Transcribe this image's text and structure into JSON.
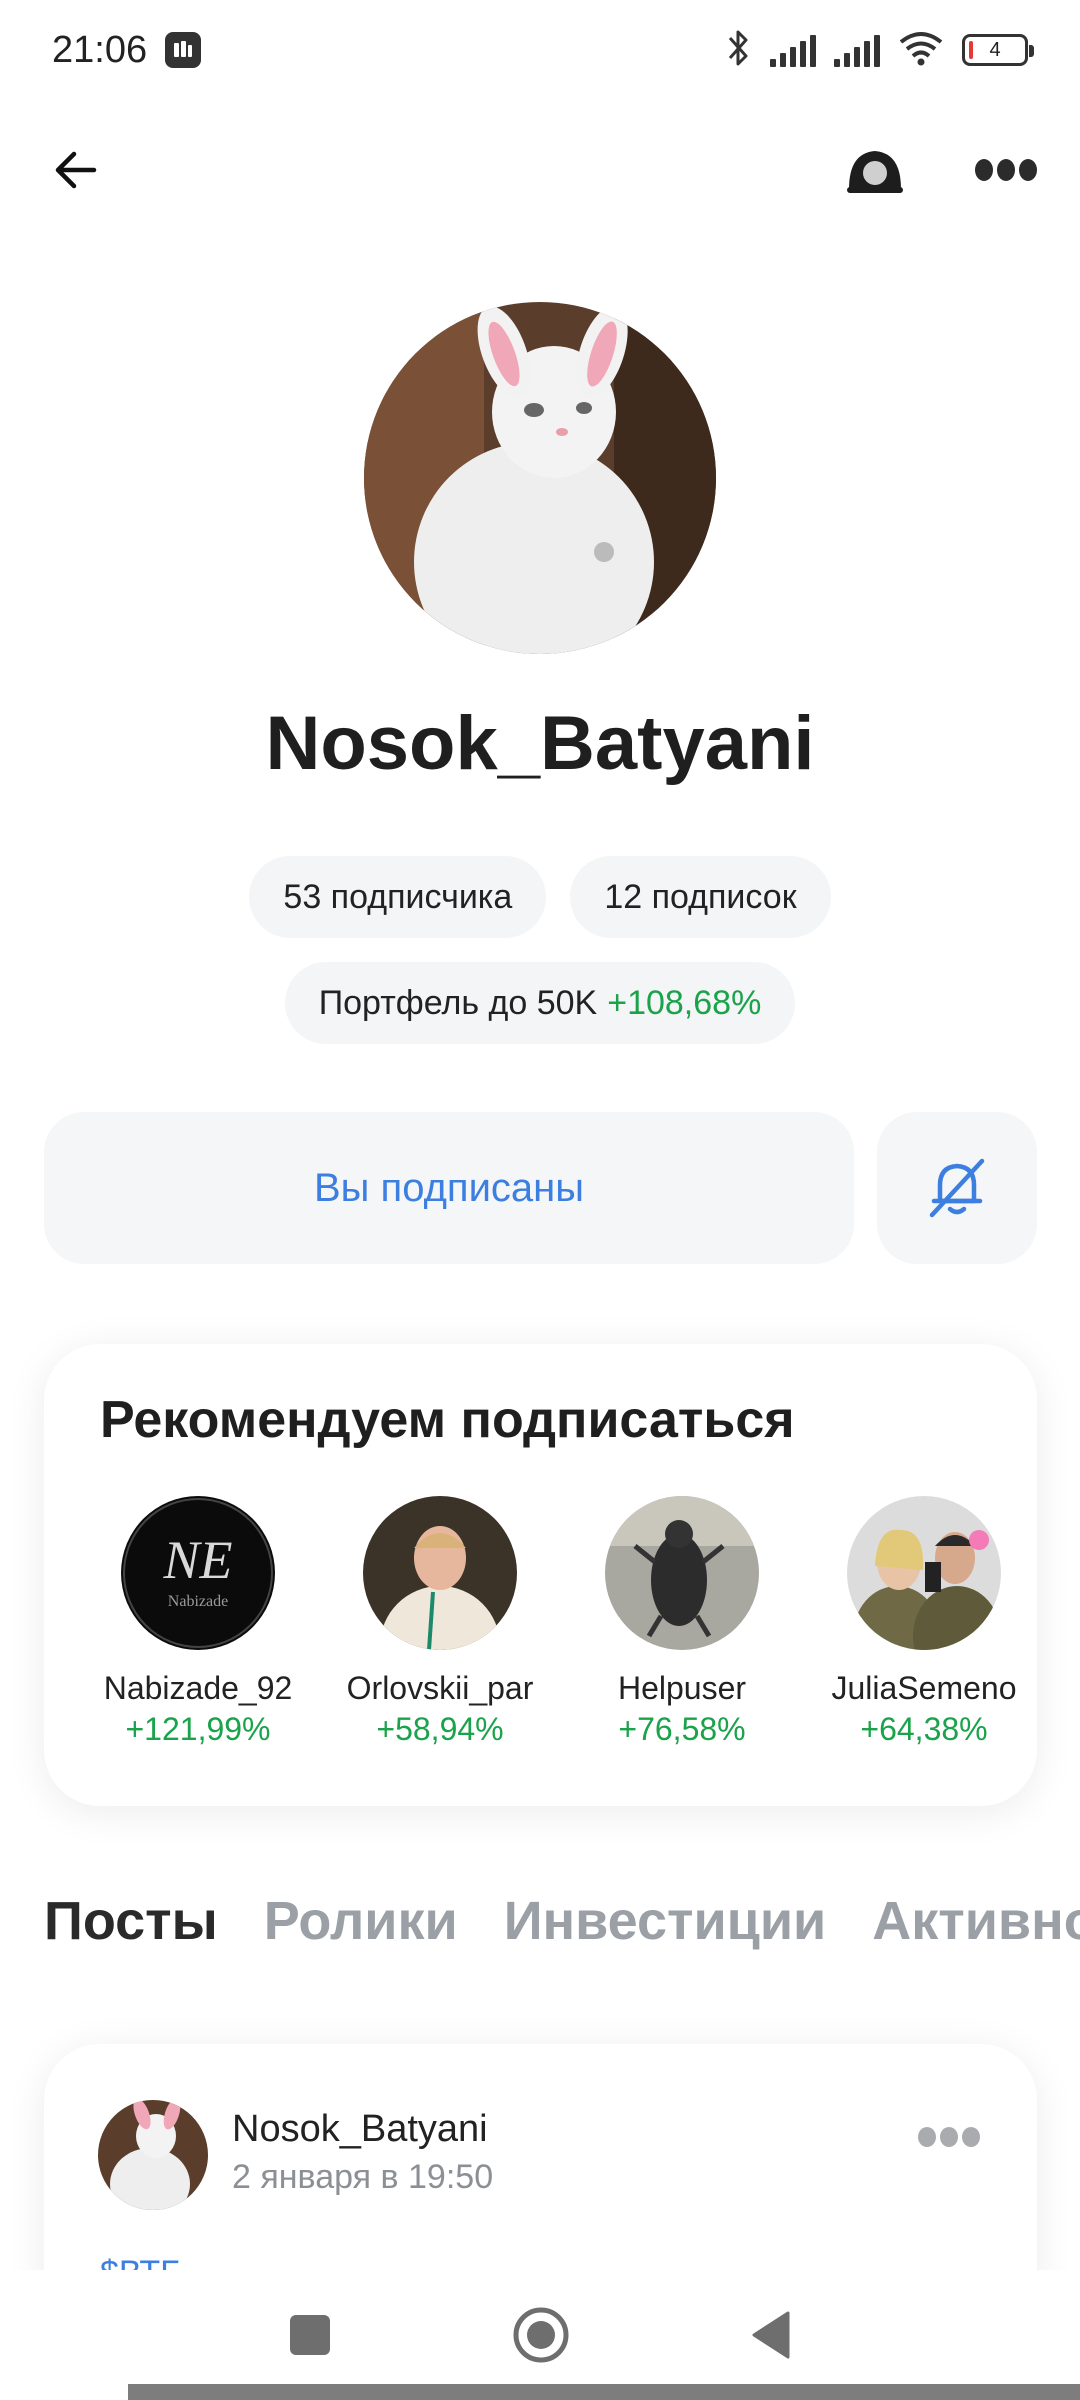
{
  "status_bar": {
    "time": "21:06",
    "battery": "4"
  },
  "top_bar": {
    "back_icon": "arrow-left-icon",
    "camera_icon": "camera-icon",
    "more_icon": "more-dots-icon"
  },
  "profile": {
    "name": "Nosok_Batyani",
    "followers": "53 подписчика",
    "following": "12 подписок",
    "portfolio_label": "Портфель до 50K",
    "portfolio_change": "+108,68%",
    "subscribed_label": "Вы подписаны",
    "bell_icon": "bell-off-icon"
  },
  "recommend": {
    "title": "Рекомендуем подписаться",
    "items": [
      {
        "name": "Nabizade_92",
        "change": "+121,99%"
      },
      {
        "name": "Orlovskii_par",
        "change": "+58,94%"
      },
      {
        "name": "Helpuser",
        "change": "+76,58%"
      },
      {
        "name": "JuliaSemeno",
        "change": "+64,38%"
      }
    ]
  },
  "tabs": [
    "Посты",
    "Ролики",
    "Инвестиции",
    "Активнос"
  ],
  "post": {
    "author": "Nosok_Batyani",
    "date": "2 января в 19:50",
    "tag": "$ВТБ"
  },
  "colors": {
    "accent": "#3d7fe0",
    "positive": "#1aa34a"
  }
}
